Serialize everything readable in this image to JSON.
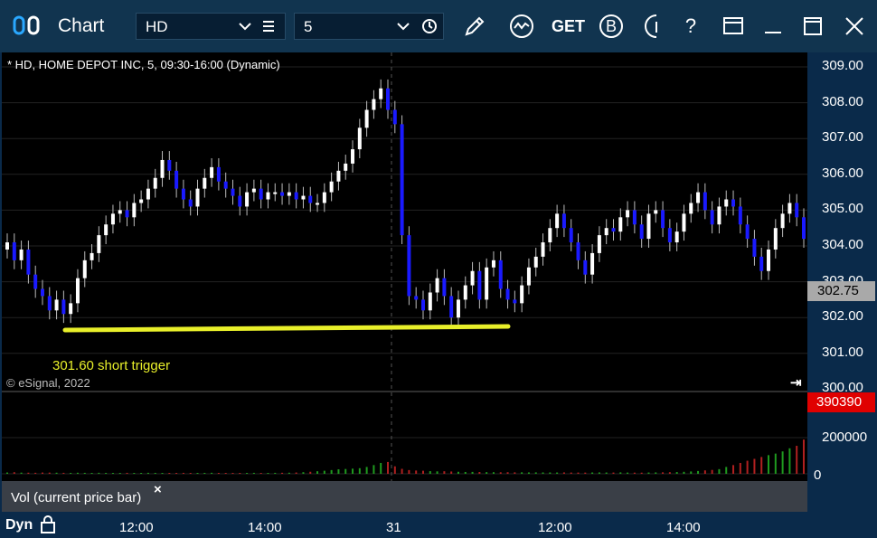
{
  "window": {
    "title": "Chart",
    "symbol": "HD",
    "interval": "5"
  },
  "toolbar": {
    "icons": [
      "draw-pencil-icon",
      "study-wave-icon",
      "get-data-icon",
      "buy-b-icon",
      "trade-icon",
      "help-icon",
      "layout-icon",
      "minimize-icon",
      "maximize-icon",
      "close-icon"
    ],
    "get_label": "GET",
    "buy_label": "B",
    "help_label": "?"
  },
  "chart": {
    "title": "* HD, HOME DEPOT INC, 5, 09:30-16:00 (Dynamic)",
    "copyright": "© eSignal, 2022",
    "annotation": "301.60 short trigger",
    "current_price": "302.75",
    "price_ticks": [
      "309.00",
      "308.00",
      "307.00",
      "306.00",
      "305.00",
      "304.00",
      "303.00",
      "302.00",
      "301.00",
      "300.00"
    ],
    "volume_badge": "390390",
    "volume_ticks": [
      "200000",
      "0"
    ],
    "volume_label": "Vol (current price bar)",
    "volume_close": "×",
    "mode_label": "Dyn",
    "time_ticks": [
      "12:00",
      "14:00",
      "31",
      "12:00",
      "14:00"
    ],
    "colors": {
      "up": "#ffffff",
      "down": "#1a1aff",
      "trigger": "#e8ef2a",
      "vol_up": "#1f9a1f",
      "vol_down": "#b02020"
    }
  },
  "chart_data": {
    "type": "candlestick",
    "trigger_level": 301.6,
    "y_range": [
      300,
      309.5
    ],
    "closes": [
      304.1,
      303.6,
      303.9,
      303.2,
      302.8,
      302.6,
      302.2,
      302.5,
      302.1,
      302.4,
      303.1,
      303.6,
      303.8,
      304.3,
      304.6,
      304.9,
      305.0,
      304.8,
      305.2,
      305.3,
      305.6,
      305.9,
      306.4,
      306.1,
      305.6,
      305.3,
      305.1,
      305.6,
      305.9,
      306.2,
      305.8,
      305.6,
      305.4,
      305.1,
      305.5,
      305.6,
      305.3,
      305.5,
      305.5,
      305.4,
      305.5,
      305.3,
      305.4,
      305.2,
      305.2,
      305.5,
      305.8,
      306.1,
      306.3,
      306.7,
      307.3,
      307.8,
      308.1,
      308.4,
      307.8,
      307.4,
      304.3,
      302.6,
      302.5,
      302.2,
      302.7,
      303.1,
      302.6,
      302.0,
      302.5,
      302.9,
      303.3,
      302.5,
      303.4,
      303.6,
      302.8,
      302.5,
      302.4,
      302.9,
      303.4,
      303.7,
      304.1,
      304.5,
      304.9,
      304.5,
      304.1,
      303.6,
      303.2,
      303.8,
      304.3,
      304.5,
      304.4,
      304.8,
      305.0,
      304.6,
      304.2,
      304.9,
      305.0,
      304.5,
      304.1,
      304.4,
      304.9,
      305.2,
      305.5,
      305.0,
      304.6,
      305.1,
      305.3,
      305.1,
      304.6,
      304.2,
      303.7,
      303.3,
      303.9,
      304.5,
      304.9,
      305.2,
      304.8,
      304.2
    ],
    "volumes": [
      4200,
      5100,
      3800,
      3600,
      3300,
      4100,
      3900,
      3500,
      3200,
      3000,
      3400,
      3100,
      2900,
      3300,
      3000,
      2800,
      2700,
      3100,
      2900,
      2800,
      3200,
      3000,
      2800,
      2700,
      2900,
      3100,
      2800,
      2600,
      3000,
      3300,
      2900,
      2800,
      3000,
      2700,
      2900,
      3100,
      2800,
      2900,
      3100,
      3300,
      3500,
      4200,
      5200,
      6500,
      8200,
      9800,
      12000,
      14500,
      15500,
      16500,
      18000,
      22000,
      28000,
      35000,
      38000,
      24000,
      16000,
      12000,
      10500,
      9800,
      8500,
      7800,
      8200,
      7400,
      6500,
      5900,
      6100,
      5800,
      5400,
      5200,
      4900,
      5100,
      4700,
      4800,
      4500,
      4600,
      4400,
      4300,
      4200,
      4500,
      4100,
      4000,
      3900,
      4300,
      4500,
      4200,
      4100,
      4600,
      4000,
      3800,
      3700,
      4200,
      4500,
      4800,
      5200,
      5600,
      6400,
      7500,
      9000,
      11000,
      12500,
      15000,
      22000,
      28000,
      35000,
      42000,
      48000,
      54000,
      60000,
      65000,
      72000,
      82000,
      90000,
      110000
    ]
  }
}
